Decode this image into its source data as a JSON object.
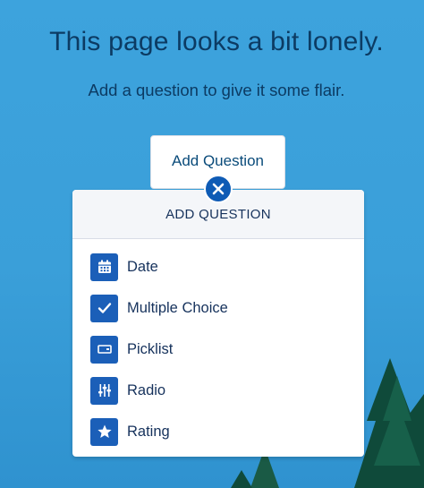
{
  "header": {
    "title": "This page looks a bit lonely.",
    "subtitle": "Add a question to give it some flair."
  },
  "add_button": {
    "label": "Add Question"
  },
  "panel": {
    "title": "ADD QUESTION",
    "items": [
      {
        "label": "Date",
        "icon": "calendar-icon"
      },
      {
        "label": "Multiple Choice",
        "icon": "checkmark-icon"
      },
      {
        "label": "Picklist",
        "icon": "picklist-icon"
      },
      {
        "label": "Radio",
        "icon": "sliders-icon"
      },
      {
        "label": "Rating",
        "icon": "star-icon"
      }
    ]
  },
  "colors": {
    "background": "#3da3dd",
    "heading_text": "#0c3b63",
    "icon_bg": "#1b5fb8",
    "close_bg": "#0e5bb5"
  }
}
